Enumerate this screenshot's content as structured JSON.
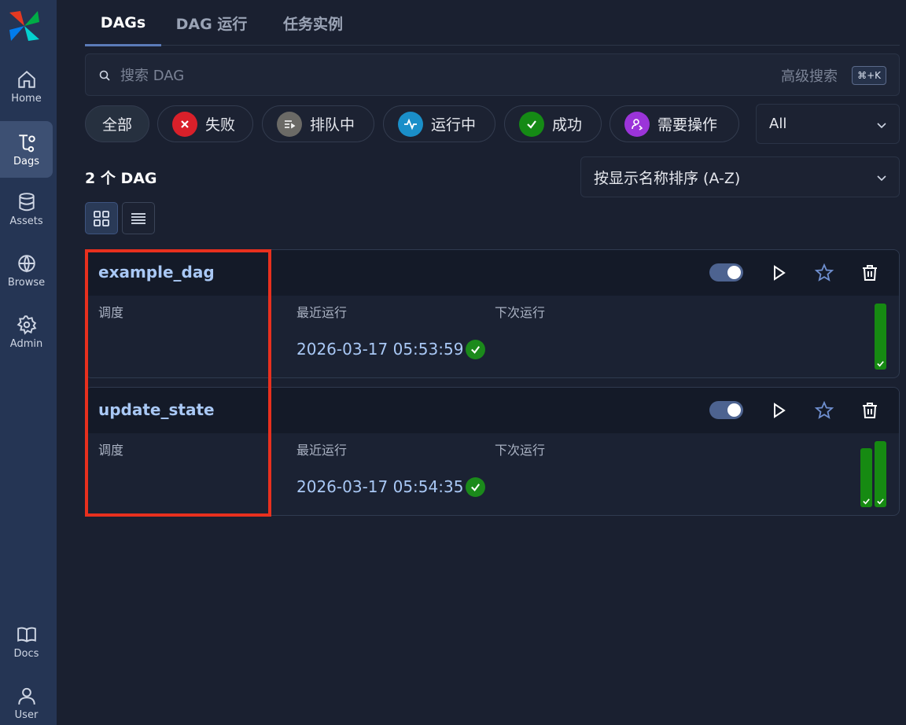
{
  "sidebar": {
    "items": [
      {
        "label": "Home",
        "icon": "home-icon"
      },
      {
        "label": "Dags",
        "icon": "dags-icon"
      },
      {
        "label": "Assets",
        "icon": "database-icon"
      },
      {
        "label": "Browse",
        "icon": "globe-icon"
      },
      {
        "label": "Admin",
        "icon": "gear-icon"
      },
      {
        "label": "Docs",
        "icon": "book-icon"
      },
      {
        "label": "User",
        "icon": "user-icon"
      }
    ],
    "active": "Dags"
  },
  "tabs": [
    {
      "label": "DAGs",
      "active": true
    },
    {
      "label": "DAG 运行",
      "active": false
    },
    {
      "label": "任务实例",
      "active": false
    }
  ],
  "search": {
    "placeholder": "搜索 DAG",
    "value": "",
    "advanced_label": "高级搜索",
    "shortcut": "⌘+K"
  },
  "filters": {
    "pills": [
      {
        "label": "全部",
        "icon": null,
        "color": null
      },
      {
        "label": "失败",
        "icon": "x-icon",
        "color": "#d9202a"
      },
      {
        "label": "排队中",
        "icon": "queue-icon",
        "color": "#6b6a66"
      },
      {
        "label": "运行中",
        "icon": "activity-icon",
        "color": "#1a8fc9"
      },
      {
        "label": "成功",
        "icon": "check-icon",
        "color": "#158a15"
      },
      {
        "label": "需要操作",
        "icon": "user-action-icon",
        "color": "#9b34d9"
      }
    ],
    "select_value": "All"
  },
  "list": {
    "count_label": "2 个 DAG",
    "sort_label": "按显示名称排序 (A-Z)"
  },
  "dags": [
    {
      "name": "example_dag",
      "schedule_label": "调度",
      "last_run_label": "最近运行",
      "next_run_label": "下次运行",
      "last_run": "2026-03-17 05:53:59",
      "last_run_status": "success",
      "paused": false
    },
    {
      "name": "update_state",
      "schedule_label": "调度",
      "last_run_label": "最近运行",
      "next_run_label": "下次运行",
      "last_run": "2026-03-17 05:54:35",
      "last_run_status": "success",
      "paused": false
    }
  ],
  "colors": {
    "success": "#168a12",
    "highlight": "#e8301e",
    "link": "#a9c8f5"
  }
}
